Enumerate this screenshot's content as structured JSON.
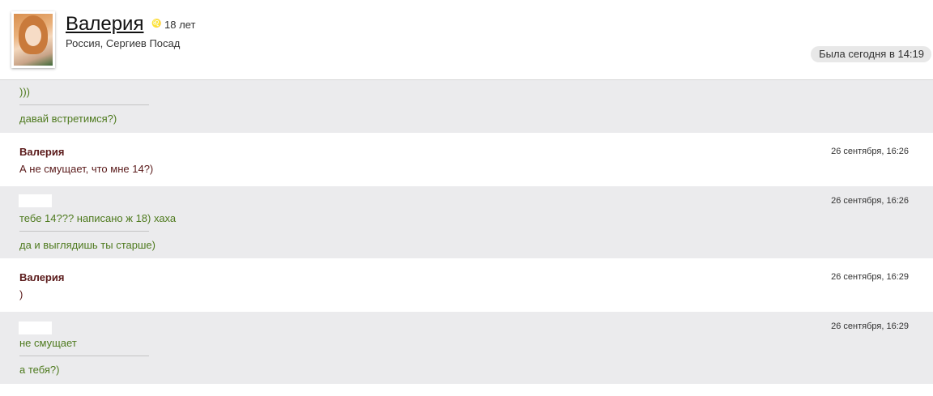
{
  "profile": {
    "name": "Валерия",
    "zodiac_icon": "leo-sign-icon",
    "age": "18 лет",
    "location": "Россия, Сергиев Посад",
    "last_seen": "Была сегодня в 14:19"
  },
  "colors": {
    "other_bg": "#ebebed",
    "other_text": "#4e7a1e",
    "mine_text": "#5a1a1a"
  },
  "messages": [
    {
      "from": "other",
      "author": "",
      "time": "",
      "lines": [
        ")))",
        "давай встретимся?)"
      ]
    },
    {
      "from": "mine",
      "author": "Валерия",
      "time": "26 сентября, 16:26",
      "lines": [
        "А не смущает, что мне 14?)"
      ]
    },
    {
      "from": "other",
      "author": "",
      "time": "26 сентября, 16:26",
      "lines": [
        "тебе 14??? написано ж 18) хаха",
        "да и выглядишь ты старше)"
      ]
    },
    {
      "from": "mine",
      "author": "Валерия",
      "time": "26 сентября, 16:29",
      "lines": [
        ")"
      ]
    },
    {
      "from": "other",
      "author": "",
      "time": "26 сентября, 16:29",
      "lines": [
        "не смущает",
        "а тебя?)"
      ]
    }
  ]
}
